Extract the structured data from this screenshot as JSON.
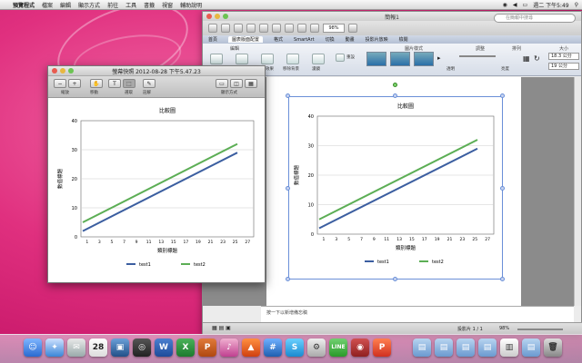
{
  "menubar": {
    "apple": "",
    "items": [
      "預覽程式",
      "檔案",
      "編輯",
      "顯示方式",
      "前往",
      "工具",
      "書籤",
      "視窗",
      "輔助說明"
    ],
    "clock": "週二 下午5:49"
  },
  "word": {
    "title": "簡報1",
    "zoom": "98%",
    "search_placeholder": "在簡報中搜尋",
    "tabs": [
      "首頁",
      "圖表版面配置",
      "格式",
      "SmartArt",
      "切換",
      "動畫",
      "投影片放映",
      "檢閱"
    ],
    "ribbon_groups": [
      "編輯",
      "圖片樣式",
      "調整",
      "排列",
      "大小"
    ],
    "ribbon_labels": [
      "裁剪",
      "重新著色",
      "陰影效果",
      "移除背景",
      "濾鏡",
      "重設",
      "透明",
      "亮度"
    ],
    "size_height": "18.3 公分",
    "size_width": "19 公分",
    "notes": "按一下以新增備忘稿",
    "status_slide": "投影片 1 / 1",
    "status_zoom": "98%"
  },
  "preview": {
    "title": "螢幕快照 2012-08-28 下午5.47.23",
    "tools": [
      "縮放",
      "移動",
      "選取",
      "註解",
      "顯示方式"
    ]
  },
  "chart_data": [
    {
      "type": "line",
      "title": "比較圖",
      "xlabel": "類別標題",
      "ylabel": "數值標題",
      "categories": [
        "1",
        "3",
        "5",
        "7",
        "9",
        "11",
        "13",
        "15",
        "17",
        "19",
        "21",
        "23",
        "25",
        "27"
      ],
      "ylim": [
        0,
        40
      ],
      "yticks": [
        0,
        10,
        20,
        30,
        40
      ],
      "grid": true,
      "legend": "bottom",
      "series": [
        {
          "name": "test1",
          "color": "#3b5ea0",
          "start": 2,
          "end": 29
        },
        {
          "name": "test2",
          "color": "#5cae55",
          "start": 5,
          "end": 32
        }
      ]
    },
    {
      "type": "line",
      "title": "比較圖",
      "xlabel": "類別標題",
      "ylabel": "數值標題",
      "categories": [
        "1",
        "3",
        "5",
        "7",
        "9",
        "11",
        "13",
        "15",
        "17",
        "19",
        "21",
        "23",
        "25",
        "27"
      ],
      "ylim": [
        0,
        40
      ],
      "yticks": [
        0,
        10,
        20,
        30,
        40
      ],
      "grid": true,
      "legend": "bottom",
      "series": [
        {
          "name": "test1",
          "color": "#3b5ea0",
          "start": 2,
          "end": 29
        },
        {
          "name": "test2",
          "color": "#5cae55",
          "start": 5,
          "end": 32
        }
      ]
    }
  ],
  "dock": [
    "finder-icon",
    "safari-icon",
    "mail-icon",
    "ical-icon",
    "iphoto-icon",
    "word-icon",
    "excel-icon",
    "powerpoint-icon",
    "itunes-icon",
    "skype-icon",
    "line-icon",
    "photo-booth-icon",
    "preview-icon",
    "trash-icon"
  ]
}
